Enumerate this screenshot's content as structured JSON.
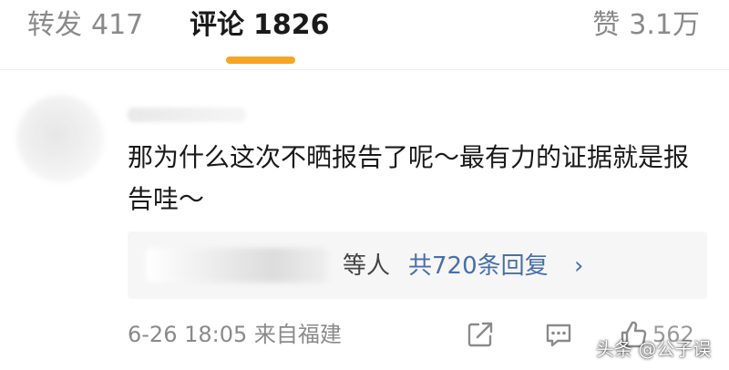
{
  "tabs": [
    {
      "label": "转发",
      "count": "417",
      "active": false
    },
    {
      "label": "评论",
      "count": "1826",
      "active": true
    },
    {
      "label": "赞",
      "count": "3.1万",
      "active": false
    }
  ],
  "colors": {
    "active_indicator": "#f5a623",
    "link_blue": "#4a6fa5",
    "muted_text": "#8a8a8a",
    "reply_box_bg": "#f6f6f6"
  },
  "comment": {
    "text": "那为什么这次不晒报告了呢～最有力的证据就是报告哇～",
    "reply_suffix": "等人",
    "reply_count": "共720条回复",
    "date": "6-26 18:05",
    "location": "来自福建",
    "like_count": "562"
  },
  "icons": {
    "share": "share-icon",
    "reply": "comment-icon",
    "like": "thumbs-up-icon",
    "more": "chevron-right-icon"
  },
  "watermark": "头条 @公子误"
}
